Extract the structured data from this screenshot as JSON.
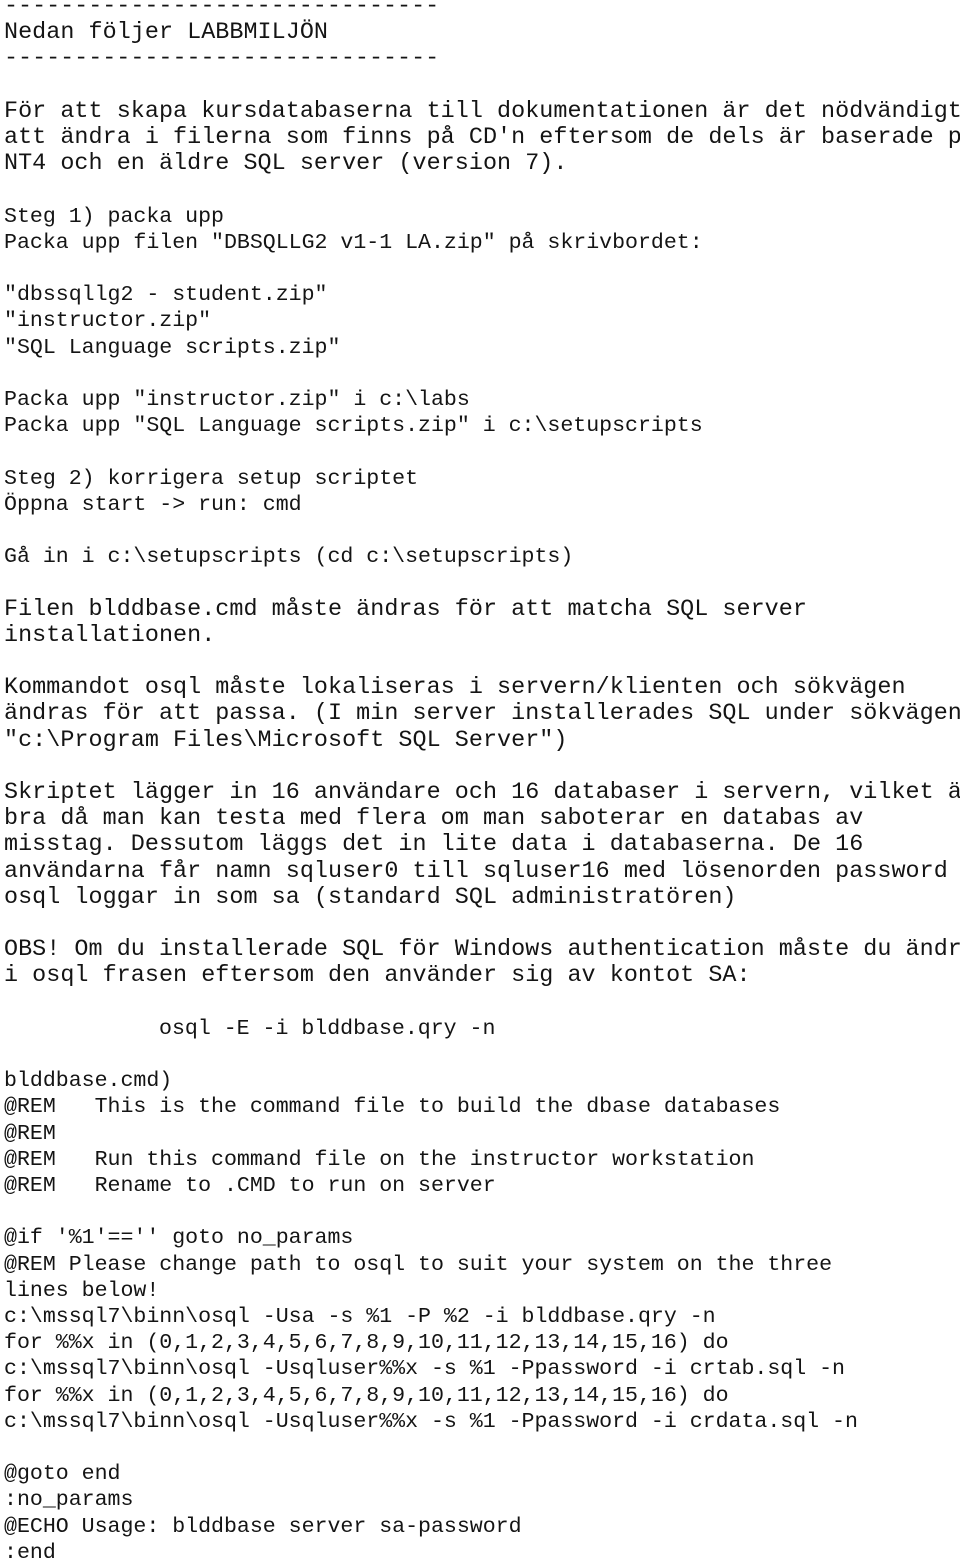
{
  "document": {
    "language": "sv",
    "title_line": "Nedan följer LABBMILJÖN",
    "rule_top": "-------------------------------",
    "rule_bottom": "-------------------------------",
    "intro": {
      "lines": [
        "För att skapa kursdatabaserna till dokumentationen är det nödvändigt",
        "att ändra i filerna som finns på CD'n eftersom de dels är baserade på",
        "NT4 och en äldre SQL server (version 7)."
      ]
    },
    "step1": {
      "heading": "Steg 1) packa upp",
      "lines": [
        "Packa upp filen \"DBSQLLG2 v1-1 LA.zip\" på skrivbordet:"
      ],
      "archives": [
        "\"dbssqllg2 - student.zip\"",
        "\"instructor.zip\"",
        "\"SQL Language scripts.zip\""
      ],
      "extract_commands": [
        "Packa upp \"instructor.zip\" i c:\\labs",
        "Packa upp \"SQL Language scripts.zip\" i c:\\setupscripts"
      ]
    },
    "step2": {
      "heading": "Steg 2) korrigera setup scriptet",
      "open_cmd": "Öppna start -> run: cmd",
      "cd_line": "Gå in i c:\\setupscripts (cd c:\\setupscripts)",
      "edit_note": [
        "Filen blddbase.cmd måste ändras för att matcha SQL server",
        "installationen."
      ],
      "path_note": [
        "Kommandot osql måste lokaliseras i servern/klienten och sökvägen",
        "ändras för att passa. (I min server installerades SQL under sökvägen",
        "\"c:\\Program Files\\Microsoft SQL Server\")"
      ],
      "script_note": [
        "Skriptet lägger in 16 användare och 16 databaser i servern, vilket är",
        "bra då man kan testa med flera om man saboterar en databas av",
        "misstag. Dessutom läggs det in lite data i databaserna. De 16",
        "användarna får namn sqluser0 till sqluser16 med lösenorden password",
        "osql loggar in som sa (standard SQL administratören)"
      ],
      "obs_note": [
        "OBS! Om du installerade SQL för Windows authentication måste du ändra",
        "i osql frasen eftersom den använder sig av kontot SA:"
      ],
      "obs_command": "osql -E -i blddbase.qry -n"
    },
    "listing": {
      "filename_line": "blddbase.cmd)",
      "header_lines": [
        "@REM   This is the command file to build the dbase databases",
        "@REM",
        "@REM   Run this command file on the instructor workstation",
        "@REM   Rename to .CMD to run on server"
      ],
      "body_lines": [
        "@if '%1'=='' goto no_params",
        "@REM Please change path to osql to suit your system on the three",
        "lines below!",
        "c:\\mssql7\\binn\\osql -Usa -s %1 -P %2 -i blddbase.qry -n",
        "for %%x in (0,1,2,3,4,5,6,7,8,9,10,11,12,13,14,15,16) do",
        "c:\\mssql7\\binn\\osql -Usqluser%%x -s %1 -Ppassword -i crtab.sql -n",
        "for %%x in (0,1,2,3,4,5,6,7,8,9,10,11,12,13,14,15,16) do",
        "c:\\mssql7\\binn\\osql -Usqluser%%x -s %1 -Ppassword -i crdata.sql -n"
      ],
      "tail_lines": [
        "@goto end",
        ":no_params",
        "@ECHO Usage: blddbase server sa-password",
        ":end"
      ]
    }
  }
}
